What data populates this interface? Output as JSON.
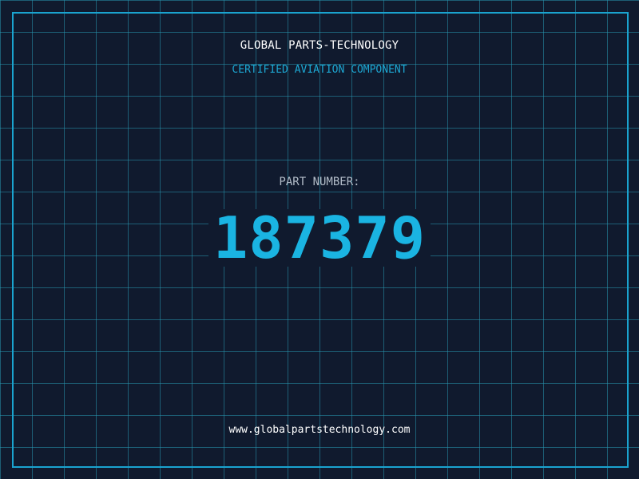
{
  "brand": {
    "name": "GLOBAL PARTS-TECHNOLOGY",
    "tagline": "CERTIFIED AVIATION COMPONENT"
  },
  "part": {
    "label": "PART NUMBER:",
    "number": "187379"
  },
  "footer": {
    "website": "www.globalpartstechnology.com"
  },
  "colors": {
    "background": "#101a2e",
    "grid": "#2896af",
    "frame": "#1aa3cf",
    "accent": "#1ab4e2",
    "label": "#b2bcc8",
    "text": "#ffffff"
  }
}
